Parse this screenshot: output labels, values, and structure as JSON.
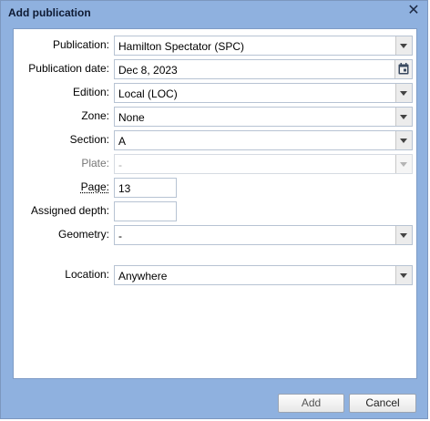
{
  "dialog": {
    "title": "Add publication",
    "close_icon": "close-icon"
  },
  "form": {
    "publication": {
      "label": "Publication:",
      "value": "Hamilton Spectator (SPC)"
    },
    "publication_date": {
      "label": "Publication date:",
      "value": "Dec 8, 2023",
      "icon": "calendar-icon"
    },
    "edition": {
      "label": "Edition:",
      "value": "Local (LOC)"
    },
    "zone": {
      "label": "Zone:",
      "value": "None"
    },
    "section": {
      "label": "Section:",
      "value": "A"
    },
    "plate": {
      "label": "Plate:",
      "value": "-",
      "disabled": true
    },
    "page": {
      "label": "Page:",
      "value": "13"
    },
    "assigned_depth": {
      "label": "Assigned depth:",
      "value": ""
    },
    "geometry": {
      "label": "Geometry:",
      "value": "-"
    },
    "location": {
      "label": "Location:",
      "value": "Anywhere"
    }
  },
  "buttons": {
    "add_label": "Add",
    "cancel_label": "Cancel"
  },
  "colors": {
    "dialog_frame": "#8fb1df",
    "panel_background": "#ffffff",
    "disabled_text": "#a7a7a7"
  }
}
